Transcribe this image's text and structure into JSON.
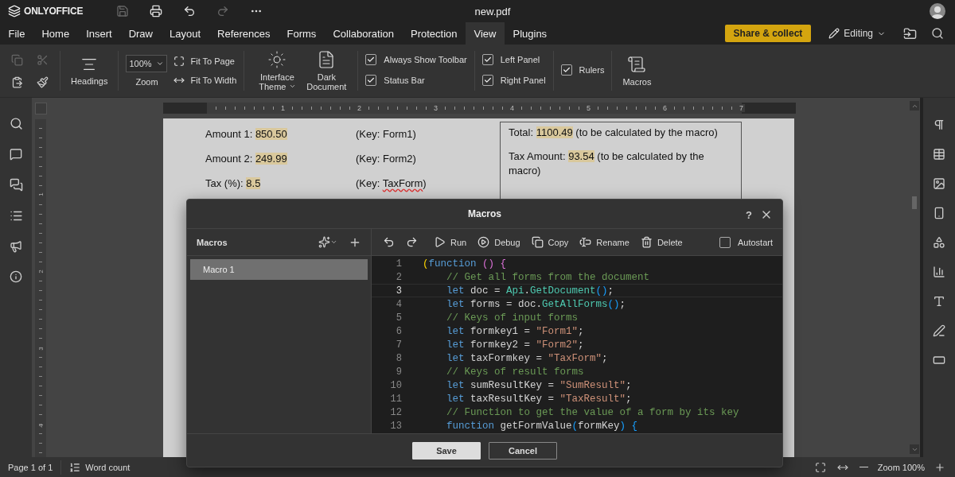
{
  "title_bar": {
    "app_name": "ONLYOFFICE",
    "document_title": "new.pdf",
    "quick_actions": [
      {
        "kind": "save",
        "disabled": true
      },
      {
        "kind": "print",
        "disabled": false
      },
      {
        "kind": "undo",
        "disabled": false
      },
      {
        "kind": "redo",
        "disabled": true
      },
      {
        "kind": "more",
        "disabled": false
      }
    ]
  },
  "menu_tabs": [
    {
      "label": "File",
      "selected": false
    },
    {
      "label": "Home",
      "selected": false
    },
    {
      "label": "Insert",
      "selected": false
    },
    {
      "label": "Draw",
      "selected": false
    },
    {
      "label": "Layout",
      "selected": false
    },
    {
      "label": "References",
      "selected": false
    },
    {
      "label": "Forms",
      "selected": false
    },
    {
      "label": "Collaboration",
      "selected": false
    },
    {
      "label": "Protection",
      "selected": false
    },
    {
      "label": "View",
      "selected": true
    },
    {
      "label": "Plugins",
      "selected": false
    }
  ],
  "share_button": "Share & collect",
  "mode": "Editing",
  "toolbar": {
    "clipboard": [
      {
        "kind": "copy",
        "disabled": true
      },
      {
        "kind": "cut",
        "disabled": true
      },
      {
        "kind": "paste",
        "disabled": false
      },
      {
        "kind": "format-painter",
        "disabled": false
      }
    ],
    "headings": "Headings",
    "zoom_value": "100%",
    "zoom_label": "Zoom",
    "fit_page": "Fit To Page",
    "fit_width": "Fit To Width",
    "interface_theme": "Interface Theme",
    "dark_document": "Dark Document",
    "option_groups": [
      {
        "items": [
          {
            "label": "Always Show Toolbar",
            "checked": true
          },
          {
            "label": "Status Bar",
            "checked": true
          }
        ]
      },
      {
        "items": [
          {
            "label": "Left Panel",
            "checked": true
          },
          {
            "label": "Right Panel",
            "checked": true
          }
        ]
      },
      {
        "items": [
          {
            "label": "Rulers",
            "checked": true
          }
        ]
      }
    ],
    "macros": "Macros"
  },
  "ruler": {
    "numbers": [
      "1",
      "2",
      "3",
      "4",
      "5",
      "6",
      "7"
    ]
  },
  "vertical_ruler": {
    "numbers": [
      "1",
      "2",
      "3",
      "4"
    ]
  },
  "document": {
    "rows": [
      {
        "label": "Amount 1: ",
        "value": "850.50",
        "key_before": "(Key: ",
        "key": "Form1",
        "key_after": ")",
        "misspelled": false
      },
      {
        "label": "Amount 2: ",
        "value": "249.99",
        "key_before": "(Key: ",
        "key": "Form2",
        "key_after": ")",
        "misspelled": false
      },
      {
        "label": "Tax (%): ",
        "value": "8.5",
        "key_before": "(Key: ",
        "key": "TaxForm",
        "key_after": ")",
        "misspelled": true
      }
    ],
    "results": [
      {
        "label": "Total: ",
        "value": "1100.49",
        "note": " (to be calculated by the macro)"
      },
      {
        "label": "Tax Amount: ",
        "value": "93.54",
        "note": " (to be calculated by the macro)"
      }
    ]
  },
  "dialog": {
    "title": "Macros",
    "help": "?",
    "list_title": "Macros",
    "macros": [
      {
        "name": "Macro 1",
        "selected": true
      }
    ],
    "actions": [
      {
        "kind": "undo"
      },
      {
        "kind": "redo"
      },
      {
        "kind": "run",
        "label": "Run"
      },
      {
        "kind": "debug",
        "label": "Debug"
      },
      {
        "kind": "copy",
        "label": "Copy"
      },
      {
        "kind": "rename",
        "label": "Rename"
      },
      {
        "kind": "delete",
        "label": "Delete"
      }
    ],
    "autostart": {
      "label": "Autostart",
      "checked": false
    },
    "code_lines": [
      {
        "number": "1",
        "current": false,
        "tokens": [
          {
            "kind": "bracket1",
            "text": "("
          },
          {
            "kind": "keyword",
            "text": "function"
          },
          {
            "kind": "bracket2",
            "text": " () {"
          }
        ]
      },
      {
        "number": "2",
        "current": false,
        "tokens": [
          {
            "kind": "comment",
            "text": "    // Get all forms from the document"
          }
        ]
      },
      {
        "number": "3",
        "current": true,
        "tokens": [
          {
            "kind": "keyword",
            "text": "    let"
          },
          {
            "kind": "plain",
            "text": " doc = "
          },
          {
            "kind": "function",
            "text": "Api"
          },
          {
            "kind": "plain",
            "text": "."
          },
          {
            "kind": "function",
            "text": "GetDocument"
          },
          {
            "kind": "bracket3",
            "text": "()"
          },
          {
            "kind": "plain",
            "text": ";"
          }
        ]
      },
      {
        "number": "4",
        "current": false,
        "tokens": [
          {
            "kind": "keyword",
            "text": "    let"
          },
          {
            "kind": "plain",
            "text": " forms = doc."
          },
          {
            "kind": "function",
            "text": "GetAllForms"
          },
          {
            "kind": "bracket3",
            "text": "()"
          },
          {
            "kind": "plain",
            "text": ";"
          }
        ]
      },
      {
        "number": "5",
        "current": false,
        "tokens": [
          {
            "kind": "comment",
            "text": "    // Keys of input forms"
          }
        ]
      },
      {
        "number": "6",
        "current": false,
        "tokens": [
          {
            "kind": "keyword",
            "text": "    let"
          },
          {
            "kind": "plain",
            "text": " formkey1 = "
          },
          {
            "kind": "string",
            "text": "\"Form1\""
          },
          {
            "kind": "plain",
            "text": ";"
          }
        ]
      },
      {
        "number": "7",
        "current": false,
        "tokens": [
          {
            "kind": "keyword",
            "text": "    let"
          },
          {
            "kind": "plain",
            "text": " formkey2 = "
          },
          {
            "kind": "string",
            "text": "\"Form2\""
          },
          {
            "kind": "plain",
            "text": ";"
          }
        ]
      },
      {
        "number": "8",
        "current": false,
        "tokens": [
          {
            "kind": "keyword",
            "text": "    let"
          },
          {
            "kind": "plain",
            "text": " taxFormkey = "
          },
          {
            "kind": "string",
            "text": "\"TaxForm\""
          },
          {
            "kind": "plain",
            "text": ";"
          }
        ]
      },
      {
        "number": "9",
        "current": false,
        "tokens": [
          {
            "kind": "comment",
            "text": "    // Keys of result forms"
          }
        ]
      },
      {
        "number": "10",
        "current": false,
        "tokens": [
          {
            "kind": "keyword",
            "text": "    let"
          },
          {
            "kind": "plain",
            "text": " sumResultKey = "
          },
          {
            "kind": "string",
            "text": "\"SumResult\""
          },
          {
            "kind": "plain",
            "text": ";"
          }
        ]
      },
      {
        "number": "11",
        "current": false,
        "tokens": [
          {
            "kind": "keyword",
            "text": "    let"
          },
          {
            "kind": "plain",
            "text": " taxResultKey = "
          },
          {
            "kind": "string",
            "text": "\"TaxResult\""
          },
          {
            "kind": "plain",
            "text": ";"
          }
        ]
      },
      {
        "number": "12",
        "current": false,
        "tokens": [
          {
            "kind": "comment",
            "text": "    // Function to get the value of a form by its key"
          }
        ]
      },
      {
        "number": "13",
        "current": false,
        "tokens": [
          {
            "kind": "keyword",
            "text": "    function"
          },
          {
            "kind": "plain",
            "text": " getFormValue"
          },
          {
            "kind": "bracket3",
            "text": "("
          },
          {
            "kind": "plain",
            "text": "formKey"
          },
          {
            "kind": "bracket3",
            "text": ") {"
          }
        ]
      }
    ],
    "buttons": [
      {
        "kind": "primary",
        "label": "Save"
      },
      {
        "kind": "secondary",
        "label": "Cancel"
      }
    ]
  },
  "status_bar": {
    "page": "Page 1 of 1",
    "word_count": "Word count",
    "zoom": "Zoom 100%"
  }
}
